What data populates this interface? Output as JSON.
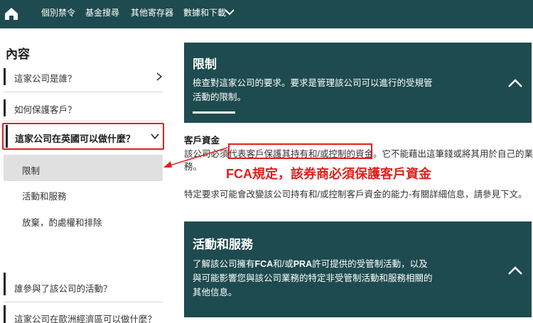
{
  "nav": {
    "items": [
      "個別禁令",
      "基金搜尋",
      "其他寄存器",
      "數據和下載"
    ]
  },
  "sidebar": {
    "title": "內容",
    "items": [
      {
        "label": "這家公司是誰？"
      },
      {
        "label": "如何保護客戶？"
      },
      {
        "label": "這家公司在英國可以做什麼？"
      },
      {
        "label": "誰參與了該公司的活動？"
      },
      {
        "label": "這家公司在歐洲經濟區可以做什麼？"
      }
    ],
    "sub_items": [
      "限制",
      "活動和服務",
      "放棄，酌處權和排除"
    ]
  },
  "panels": {
    "limits": {
      "title": "限制",
      "desc": "檢查對這家公司的要求。要求是管理該公司可以進行的受規管活動的限制。"
    },
    "activities": {
      "title": "活動和服務",
      "desc_pre": "了解該公司擁有",
      "desc_fca": "FCA",
      "desc_mid": "和/或",
      "desc_pra": "PRA",
      "desc_post": "許可提供的受管制活動，以及與可能影響您與該公司業務的特定非受管制活動和服務相關的其他信息。"
    }
  },
  "content": {
    "heading": "客戶資金",
    "line1": "該公司必須代表客戶保護其持有和/或控制的資金。它不能藉出這筆錢或將其用於自己的業",
    "line2": "務。",
    "line3": "特定要求可能會改變該公司持有和/或控制客戶資金的能力-有關詳細信息，請參見下文。"
  },
  "annotation": "FCA規定，該券商必須保護客戶資金",
  "colors": {
    "brand": "#1e4b4f",
    "annotation": "#e0201d"
  }
}
